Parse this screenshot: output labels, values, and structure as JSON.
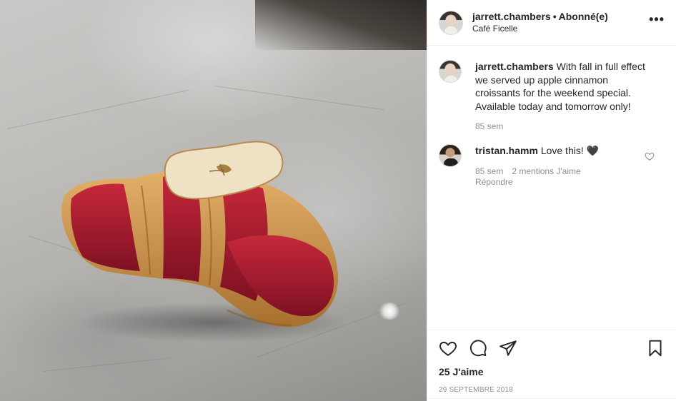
{
  "header": {
    "username": "jarrett.chambers",
    "separator": "•",
    "follow_status": "Abonné(e)",
    "location": "Café Ficelle",
    "more_icon": "more-horizontal-icon"
  },
  "caption": {
    "username": "jarrett.chambers",
    "text": "With fall in full effect we served up apple cinnamon croissants for the weekend special. Available today and tomorrow only!",
    "time": "85 sem"
  },
  "comments": [
    {
      "username": "tristan.hamm",
      "text": "Love this!",
      "emoji": "🖤",
      "time": "85 sem",
      "likes": "2 mentions J'aime",
      "reply_label": "Répondre"
    }
  ],
  "actions": {
    "like_icon": "heart-icon",
    "comment_icon": "comment-icon",
    "share_icon": "share-icon",
    "save_icon": "bookmark-icon"
  },
  "likes_label": "25 J'aime",
  "date": "29 SEPTEMBRE 2018",
  "colors": {
    "text": "#262626",
    "secondary": "#8e8e8e",
    "border": "#efefef"
  }
}
